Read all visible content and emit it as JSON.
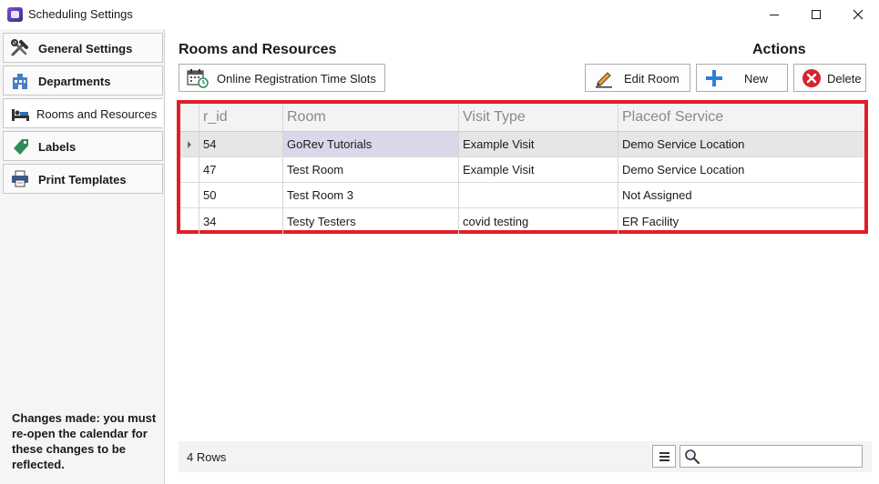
{
  "window": {
    "title": "Scheduling Settings",
    "icon": "app-logo-icon"
  },
  "sidebar": {
    "items": [
      {
        "label": "General Settings",
        "icon": "tools-icon",
        "active": false
      },
      {
        "label": "Departments",
        "icon": "building-icon",
        "active": false
      },
      {
        "label": "Rooms and Resources",
        "icon": "bed-icon",
        "active": true
      },
      {
        "label": "Labels",
        "icon": "tag-icon",
        "active": false
      },
      {
        "label": "Print Templates",
        "icon": "printer-icon",
        "active": false
      }
    ],
    "footnote": "Changes made: you must re-open the calendar for these changes to be reflected."
  },
  "main": {
    "section_title": "Rooms and Resources",
    "actions_title": "Actions",
    "buttons": {
      "online_slots": "Online Registration Time Slots",
      "edit_room": "Edit Room",
      "new": "New",
      "delete": "Delete"
    },
    "table": {
      "columns": [
        "r_id",
        "Room",
        "Visit Type",
        "Placeof Service"
      ],
      "rows": [
        {
          "r_id": "54",
          "room": "GoRev Tutorials",
          "visit_type": "Example Visit",
          "place": "Demo Service Location",
          "selected": true
        },
        {
          "r_id": "47",
          "room": "Test Room",
          "visit_type": "Example Visit",
          "place": "Demo Service Location",
          "selected": false
        },
        {
          "r_id": "50",
          "room": "Test Room 3",
          "visit_type": "",
          "place": "Not Assigned",
          "selected": false
        },
        {
          "r_id": "34",
          "room": "Testy Testers",
          "visit_type": "covid testing",
          "place": "ER Facility",
          "selected": false
        }
      ]
    },
    "status": {
      "row_count": "4 Rows",
      "search_value": ""
    }
  },
  "colors": {
    "highlight_border": "#e01e2a",
    "new_icon": "#2f7fd6",
    "delete_icon": "#d9232f"
  }
}
